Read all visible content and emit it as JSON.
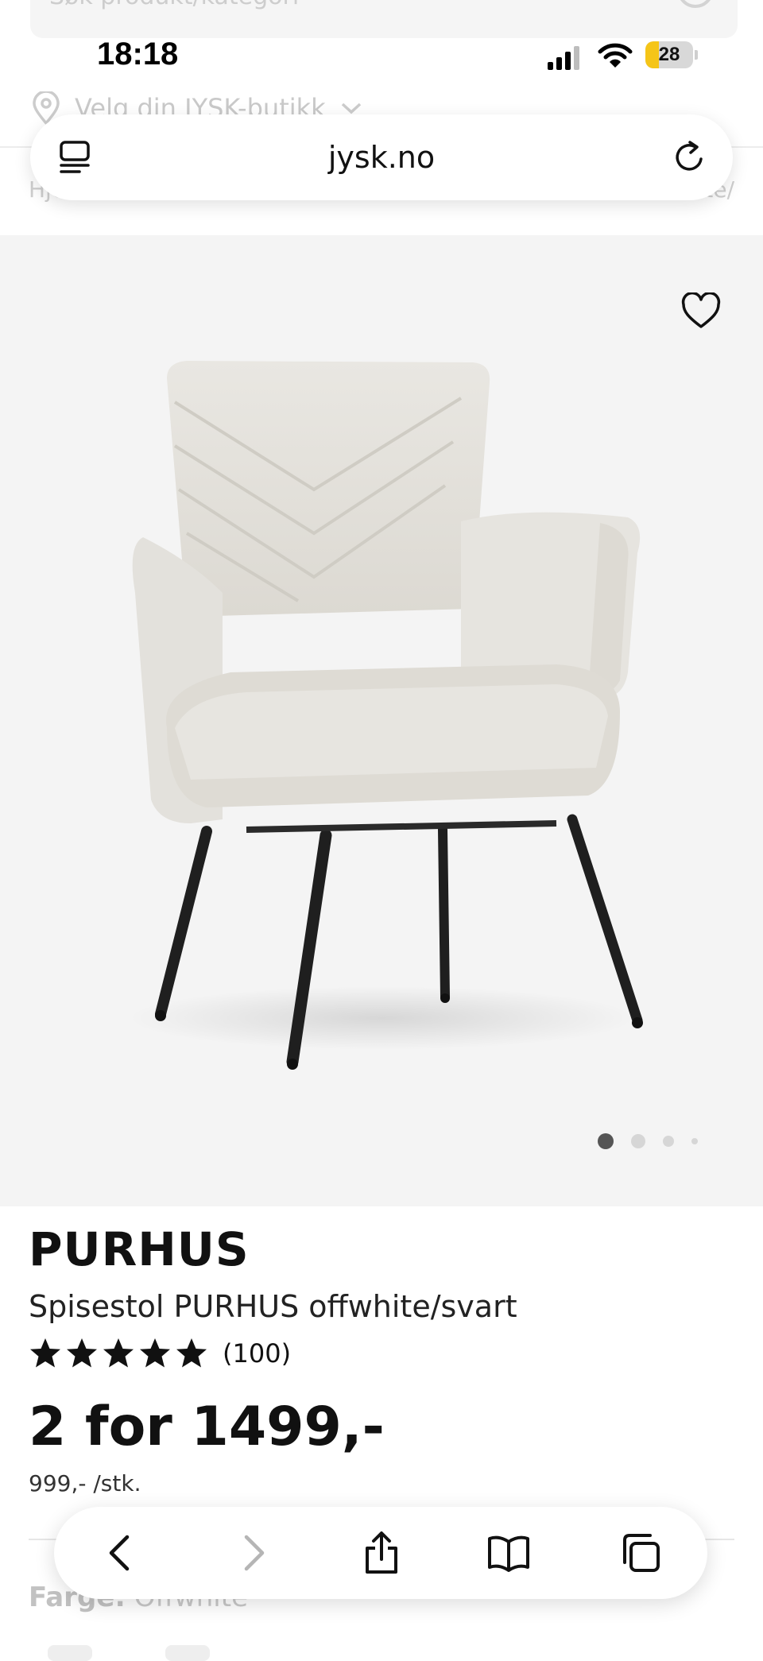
{
  "status_bar": {
    "time": "18:18",
    "battery": "28",
    "battery_level": 0.28
  },
  "browser": {
    "domain": "jysk.no"
  },
  "page_header": {
    "search_placeholder": "Søk produkt/kategori",
    "store_selector": "Velg din JYSK-butikk",
    "breadcrumb_start": "Hje",
    "breadcrumb_end": "te/"
  },
  "gallery": {
    "image_count": 4,
    "active_index": 0
  },
  "product": {
    "brand": "PURHUS",
    "title": "Spisestol PURHUS offwhite/svart",
    "rating_stars": 5,
    "review_count": "(100)",
    "price": "2 for 1499,-",
    "unit_price": "999,- /stk.",
    "color_label": "Farge:",
    "color_value": "Offwhite"
  },
  "colors": {
    "rating_star": "#111111",
    "battery_fill": "#f5c518",
    "gallery_bg": "#f4f4f4"
  },
  "icons": [
    "menu-icon",
    "reload-icon",
    "heart-icon",
    "back-icon",
    "forward-icon",
    "share-icon",
    "bookmarks-icon",
    "tabs-icon",
    "location-pin-icon",
    "search-icon"
  ]
}
